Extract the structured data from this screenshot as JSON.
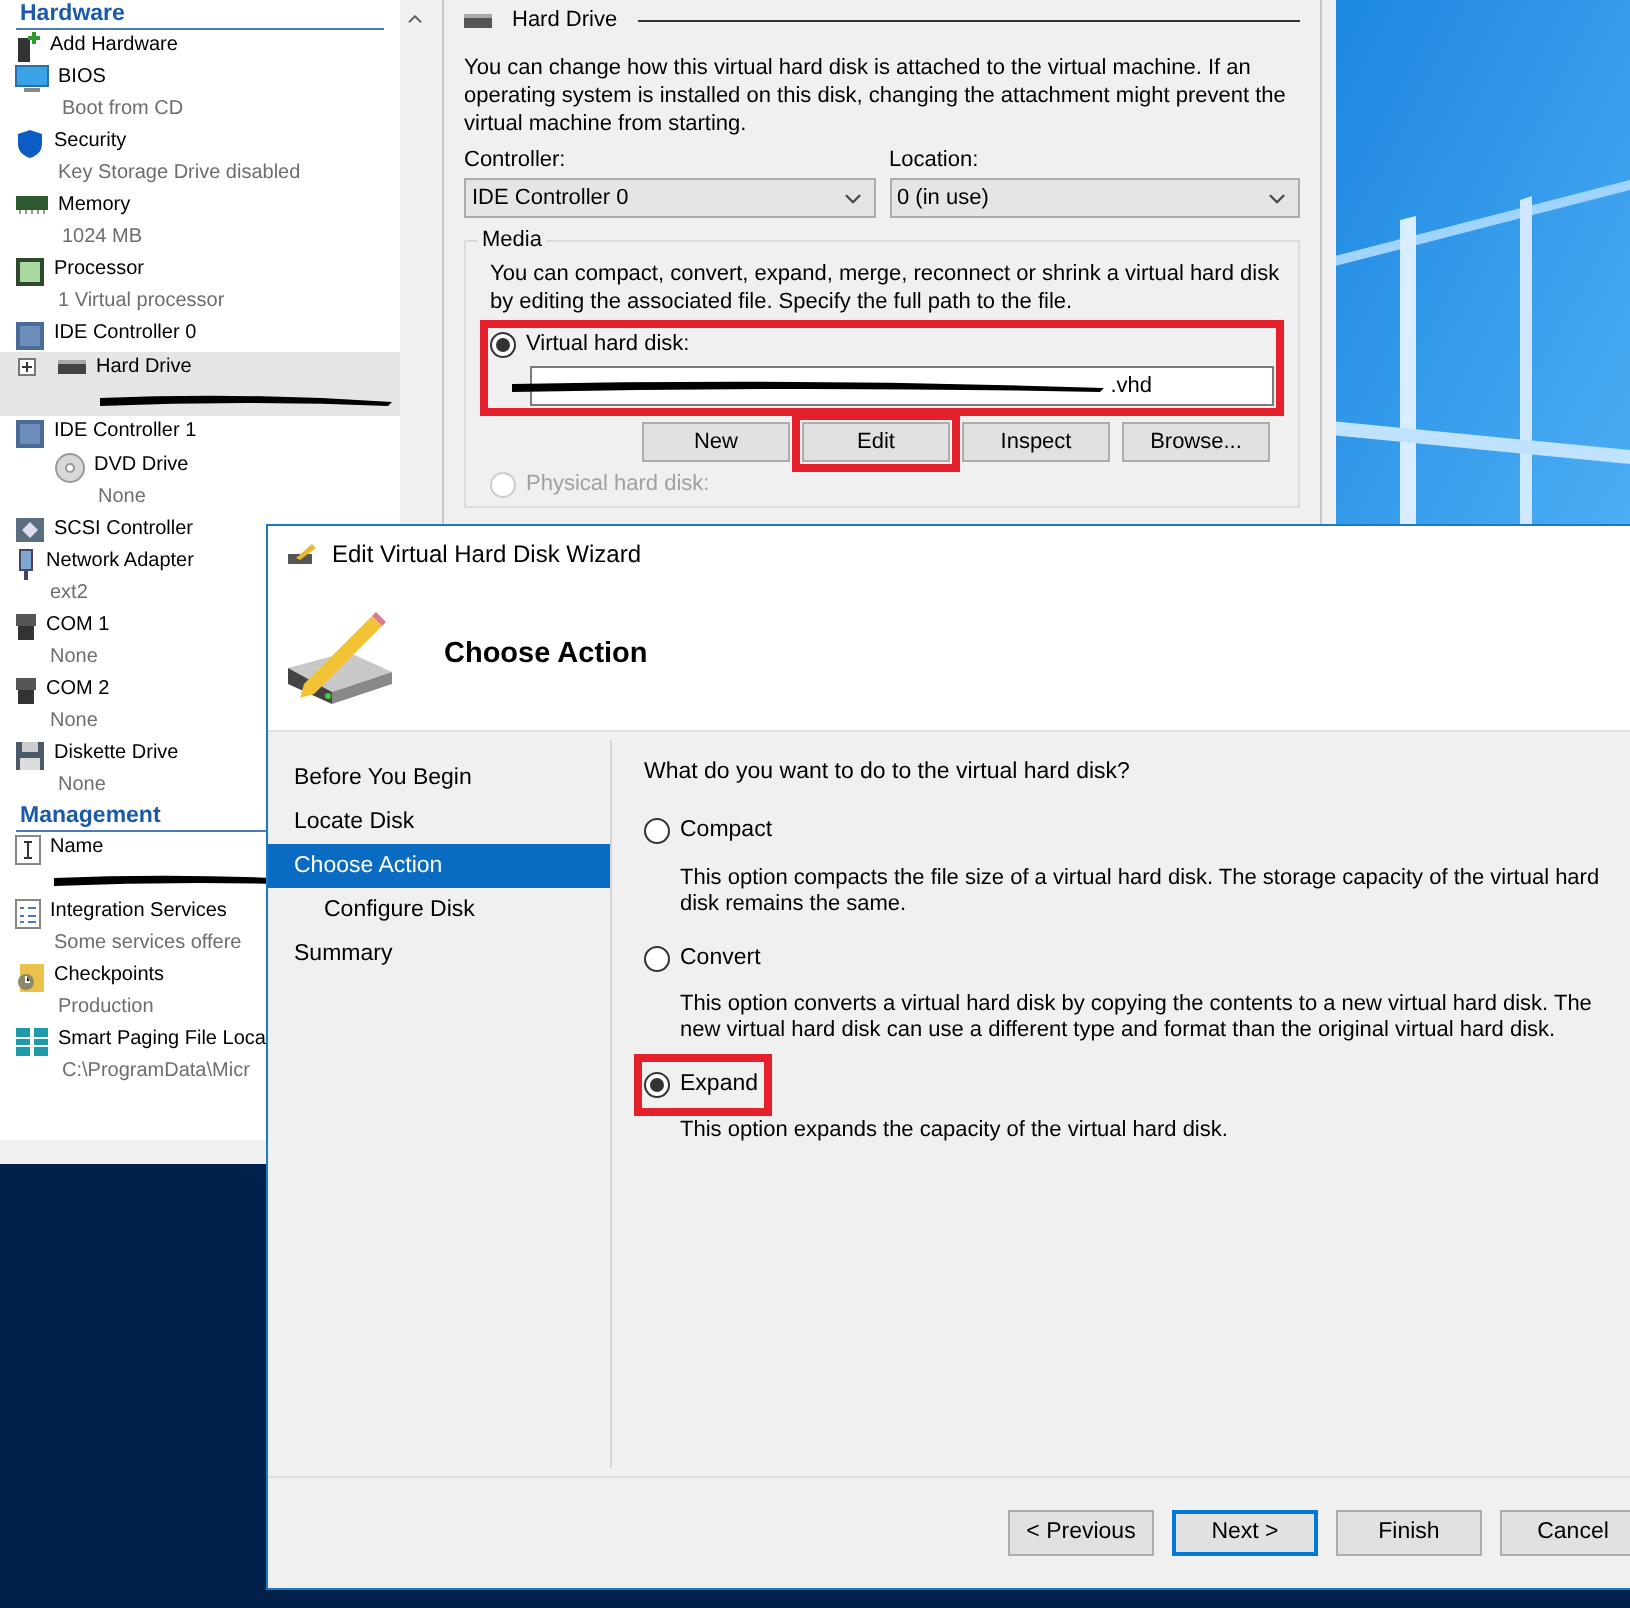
{
  "sidebar": {
    "sections": [
      {
        "title": "Hardware",
        "items": [
          {
            "kind": "add",
            "label": "Add Hardware",
            "selected": false
          },
          {
            "kind": "display",
            "label": "BIOS",
            "sub": "Boot from CD",
            "selected": false
          },
          {
            "kind": "shield",
            "label": "Security",
            "sub": "Key Storage Drive disabled",
            "selected": false
          },
          {
            "kind": "memory",
            "label": "Memory",
            "sub": "1024 MB",
            "selected": false
          },
          {
            "kind": "chip",
            "label": "Processor",
            "sub": "1 Virtual processor",
            "selected": false
          },
          {
            "kind": "controller",
            "label": "IDE Controller 0",
            "selected": false,
            "children": [
              {
                "kind": "disk",
                "label": "Hard Drive",
                "selected": true,
                "expanded": false,
                "redacted": true
              }
            ]
          },
          {
            "kind": "controller",
            "label": "IDE Controller 1",
            "selected": false,
            "children": [
              {
                "kind": "dvd",
                "label": "DVD Drive",
                "sub": "None",
                "selected": false
              }
            ]
          },
          {
            "kind": "scsi",
            "label": "SCSI Controller",
            "selected": false
          },
          {
            "kind": "network",
            "label": "Network Adapter",
            "sub": "ext2",
            "selected": false
          },
          {
            "kind": "port",
            "label": "COM 1",
            "sub": "None",
            "selected": false
          },
          {
            "kind": "port",
            "label": "COM 2",
            "sub": "None",
            "selected": false
          },
          {
            "kind": "floppy",
            "label": "Diskette Drive",
            "sub": "None",
            "selected": false
          }
        ]
      },
      {
        "title": "Management",
        "items": [
          {
            "kind": "name",
            "label": "Name",
            "selected": false,
            "redacted": true
          },
          {
            "kind": "services",
            "label": "Integration Services",
            "sub": "Some services offere",
            "selected": false
          },
          {
            "kind": "checkpoint",
            "label": "Checkpoints",
            "sub": "Production",
            "selected": false
          },
          {
            "kind": "paging",
            "label": "Smart Paging File Loca",
            "sub": "C:\\ProgramData\\Micr",
            "selected": false
          }
        ]
      }
    ]
  },
  "settings": {
    "title": "Hard Drive",
    "intro": "You can change how this virtual hard disk is attached to the virtual machine. If an operating system is installed on this disk, changing the attachment might prevent the virtual machine from starting.",
    "controller": {
      "label": "Controller:",
      "value": "IDE Controller 0"
    },
    "location": {
      "label": "Location:",
      "value": "0 (in use)"
    },
    "media": {
      "title": "Media",
      "text": "You can compact, convert, expand, merge, reconnect or shrink a virtual hard disk by editing the associated file. Specify the full path to the file.",
      "virtual_disk": {
        "label": "Virtual hard disk:",
        "selected": true,
        "highlighted": true,
        "value": ".vhd",
        "redacted": true
      },
      "buttons": [
        {
          "label": "New",
          "highlighted": false
        },
        {
          "label": "Edit",
          "highlighted": true
        },
        {
          "label": "Inspect",
          "highlighted": false
        },
        {
          "label": "Browse...",
          "highlighted": false
        }
      ],
      "physical_disk": {
        "label": "Physical hard disk:",
        "selected": false,
        "disabled": true
      }
    }
  },
  "wizard": {
    "title": "Edit Virtual Hard Disk Wizard",
    "heading": "Choose Action",
    "steps": [
      {
        "label": "Before You Begin",
        "selected": false
      },
      {
        "label": "Locate Disk",
        "selected": false
      },
      {
        "label": "Choose Action",
        "selected": true,
        "children": [
          {
            "label": "Configure Disk",
            "selected": false
          }
        ]
      },
      {
        "label": "Summary",
        "selected": false
      }
    ],
    "question": "What do you want to do to the virtual hard disk?",
    "options": [
      {
        "label": "Compact",
        "description": "This option compacts the file size of a virtual hard disk. The storage capacity of the virtual hard disk remains the same.",
        "selected": false,
        "highlighted": false
      },
      {
        "label": "Convert",
        "description": "This option converts a virtual hard disk by copying the contents to a new virtual hard disk. The new virtual hard disk can use a different type and format than the original virtual hard disk.",
        "selected": false,
        "highlighted": false
      },
      {
        "label": "Expand",
        "description": "This option expands the capacity of the virtual hard disk.",
        "selected": true,
        "highlighted": true
      }
    ],
    "buttons": [
      {
        "label": "< Previous",
        "default": false
      },
      {
        "label": "Next >",
        "default": true
      },
      {
        "label": "Finish",
        "default": false
      },
      {
        "label": "Cancel",
        "default": false
      }
    ]
  }
}
